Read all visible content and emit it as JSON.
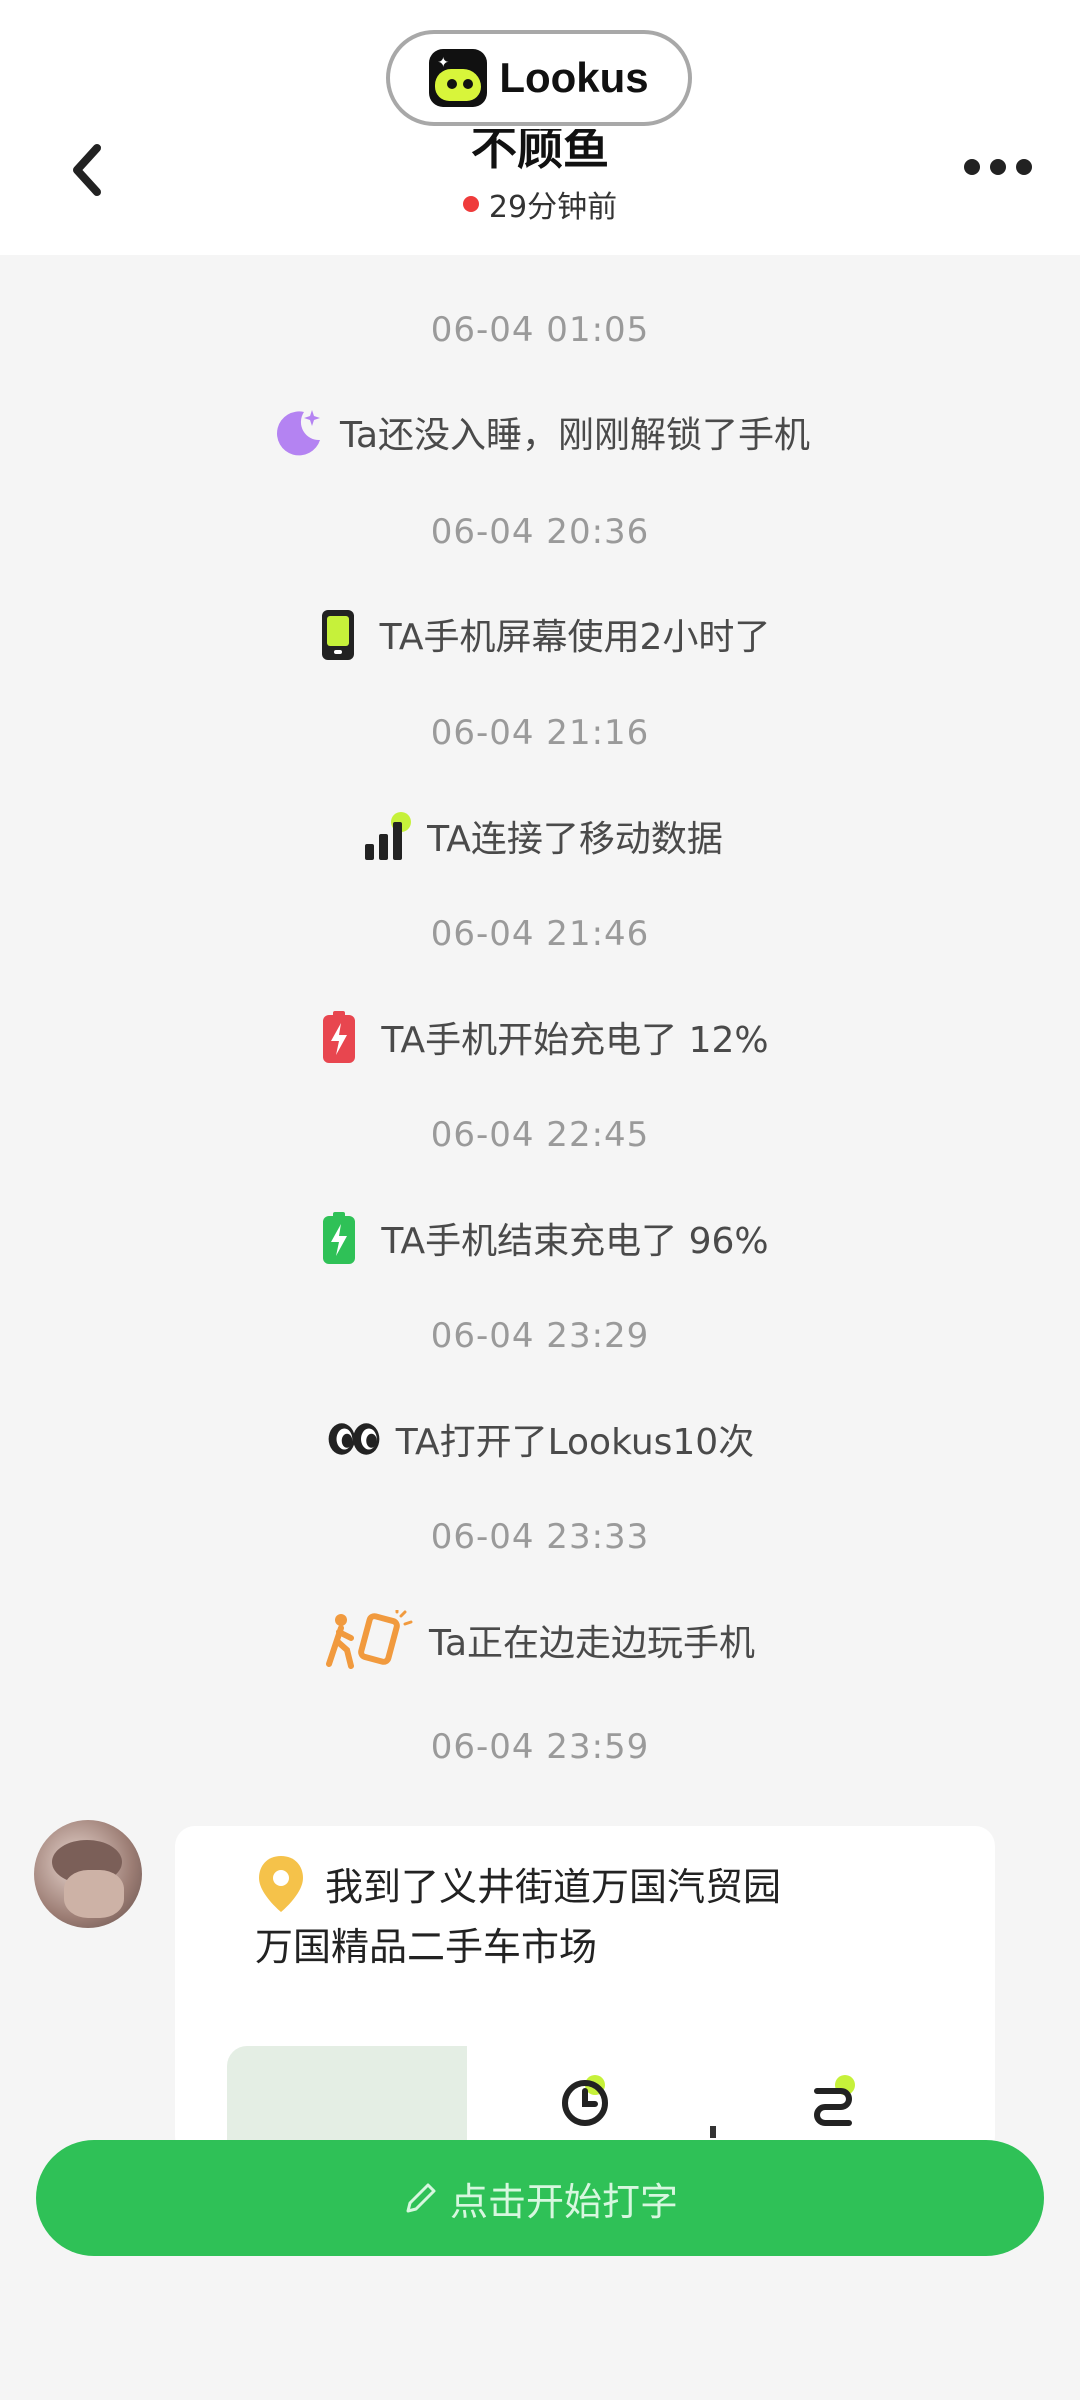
{
  "header": {
    "title": "不顾鱼",
    "status_text": "29分钟前",
    "status_color": "#ef3b3b"
  },
  "overlay": {
    "app_name": "Lookus"
  },
  "events": [
    {
      "time": "06-04 01:05",
      "text": "Ta还没入睡，刚刚解锁了手机",
      "icon": "moon-icon"
    },
    {
      "time": "06-04 20:36",
      "text": "TA手机屏幕使用2小时了",
      "icon": "phone-screen-icon"
    },
    {
      "time": "06-04 21:16",
      "text": "TA连接了移动数据",
      "icon": "signal-bars-icon"
    },
    {
      "time": "06-04 21:46",
      "text": "TA手机开始充电了 12%",
      "icon": "battery-low-icon"
    },
    {
      "time": "06-04 22:45",
      "text": "TA手机结束充电了 96%",
      "icon": "battery-full-icon"
    },
    {
      "time": "06-04 23:29",
      "text": "TA打开了Lookus10次",
      "icon": "eyes-icon"
    },
    {
      "time": "06-04 23:33",
      "text": "Ta正在边走边玩手机",
      "icon": "walking-phone-icon"
    }
  ],
  "last_time": "06-04 23:59",
  "location_card": {
    "line1": "我到了义井街道万国汽贸园",
    "line2": "万国精品二手车市场"
  },
  "input": {
    "label": "点击开始打字"
  },
  "colors": {
    "accent_green": "#2fc157",
    "lime": "#c6f13a",
    "purple": "#b483f2"
  }
}
